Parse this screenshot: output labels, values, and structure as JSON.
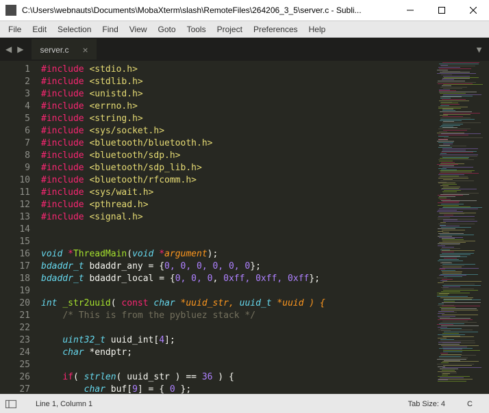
{
  "window": {
    "title": "C:\\Users\\webnauts\\Documents\\MobaXterm\\slash\\RemoteFiles\\264206_3_5\\server.c - Subli..."
  },
  "menu": [
    "File",
    "Edit",
    "Selection",
    "Find",
    "View",
    "Goto",
    "Tools",
    "Project",
    "Preferences",
    "Help"
  ],
  "tabs": [
    {
      "name": "server.c",
      "active": true
    }
  ],
  "gutter_lines": [
    "1",
    "2",
    "3",
    "4",
    "5",
    "6",
    "7",
    "8",
    "9",
    "10",
    "11",
    "12",
    "13",
    "14",
    "15",
    "16",
    "17",
    "18",
    "19",
    "20",
    "21",
    "22",
    "23",
    "24",
    "25",
    "26",
    "27"
  ],
  "code": {
    "includes": [
      "<stdio.h>",
      "<stdlib.h>",
      "<unistd.h>",
      "<errno.h>",
      "<string.h>",
      "<sys/socket.h>",
      "<bluetooth/bluetooth.h>",
      "<bluetooth/sdp.h>",
      "<bluetooth/sdp_lib.h>",
      "<bluetooth/rfcomm.h>",
      "<sys/wait.h>",
      "<pthread.h>",
      "<signal.h>"
    ],
    "l16": {
      "void": "void",
      "star": "*",
      "fn": "ThreadMain",
      "arg": "argument",
      "close": ");"
    },
    "l17": {
      "type": "bdaddr_t",
      "name": "bdaddr_any = {",
      "vals": "0, 0, 0, 0, 0, 0",
      "end": "};"
    },
    "l18": {
      "type": "bdaddr_t",
      "name": "bdaddr_local = {",
      "v1": "0, 0, 0",
      "v2": "0xff, 0xff, 0xff",
      "end": "};"
    },
    "l20": {
      "int": "int",
      "fn": "_str2uuid",
      "const": "const",
      "char": "char",
      "p1": "*uuid_str, ",
      "t2": "uuid_t",
      "p2": " *uuid ) {"
    },
    "l21": {
      "cmt": "/* This is from the pybluez stack */"
    },
    "l23": {
      "type": "uint32_t",
      "name": " uuid_int[",
      "n": "4",
      "end": "];"
    },
    "l24": {
      "type": "char",
      "rest": " *endptr;"
    },
    "l26": {
      "if": "if",
      "fn": "strlen",
      "arg": "( uuid_str ) == ",
      "n": "36",
      "end": " ) {"
    },
    "l27": {
      "type": "char",
      "pre": " buf[",
      "n": "9",
      "mid": "] = { ",
      "z": "0",
      "end": " };"
    }
  },
  "status": {
    "position": "Line 1, Column 1",
    "tabsize": "Tab Size: 4",
    "syntax": "C"
  },
  "chart_data": {
    "type": "code",
    "language": "C",
    "filename": "server.c",
    "visible_line_range": [
      1,
      27
    ],
    "content": "#include <stdio.h>\n#include <stdlib.h>\n#include <unistd.h>\n#include <errno.h>\n#include <string.h>\n#include <sys/socket.h>\n#include <bluetooth/bluetooth.h>\n#include <bluetooth/sdp.h>\n#include <bluetooth/sdp_lib.h>\n#include <bluetooth/rfcomm.h>\n#include <sys/wait.h>\n#include <pthread.h>\n#include <signal.h>\n\n\nvoid *ThreadMain(void *argument);\nbdaddr_t bdaddr_any = {0, 0, 0, 0, 0, 0};\nbdaddr_t bdaddr_local = {0, 0, 0, 0xff, 0xff, 0xff};\n\nint _str2uuid( const char *uuid_str, uuid_t *uuid ) {\n    /* This is from the pybluez stack */\n\n    uint32_t uuid_int[4];\n    char *endptr;\n\n    if( strlen( uuid_str ) == 36 ) {\n        char buf[9] = { 0 };"
  }
}
